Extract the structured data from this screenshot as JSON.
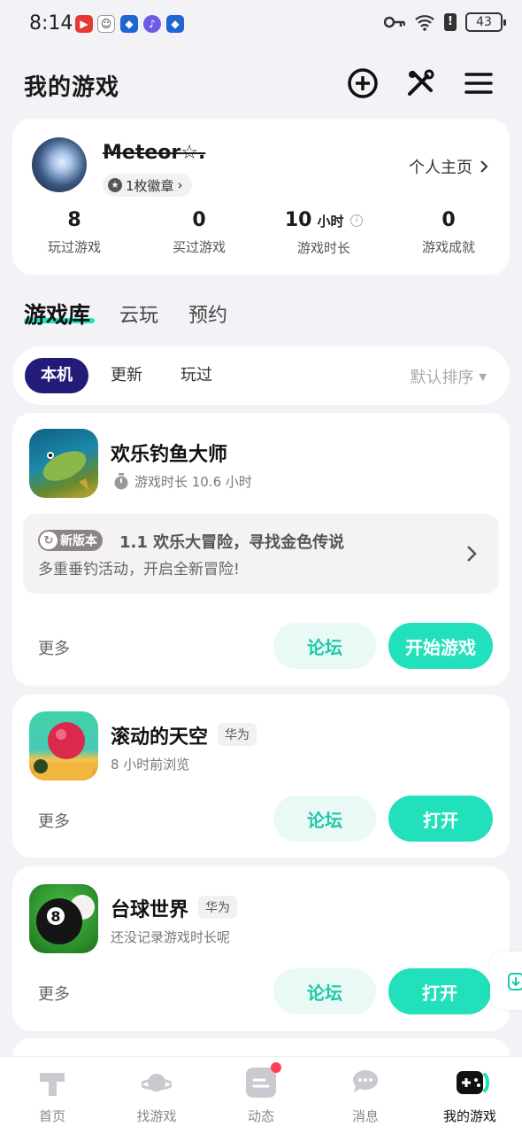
{
  "status_bar": {
    "time": "8:14",
    "battery": "43"
  },
  "header": {
    "title": "我的游戏"
  },
  "profile": {
    "username": "Meteor☆.",
    "badge": "1枚徽章",
    "homepage_link": "个人主页",
    "stats": [
      {
        "value": "8",
        "unit": "",
        "label": "玩过游戏"
      },
      {
        "value": "0",
        "unit": "",
        "label": "买过游戏"
      },
      {
        "value": "10",
        "unit": "小时",
        "label": "游戏时长"
      },
      {
        "value": "0",
        "unit": "",
        "label": "游戏成就"
      }
    ]
  },
  "library_tabs": [
    "游戏库",
    "云玩",
    "预约"
  ],
  "filters": {
    "chips": [
      "本机",
      "更新",
      "玩过"
    ],
    "sort": "默认排序"
  },
  "games": [
    {
      "name": "欢乐钓鱼大师",
      "subtitle": "游戏时长 10.6 小时",
      "news_tag": "新版本",
      "news_title": "1.1 欢乐大冒险，寻找金色传说",
      "news_subtitle": "多重垂钓活动，开启全新冒险!",
      "more": "更多",
      "forum": "论坛",
      "action": "开始游戏"
    },
    {
      "name": "滚动的天空",
      "tag": "华为",
      "subtitle": "8 小时前浏览",
      "more": "更多",
      "forum": "论坛",
      "action": "打开"
    },
    {
      "name": "台球世界",
      "tag": "华为",
      "subtitle": "还没记录游戏时长呢",
      "more": "更多",
      "forum": "论坛",
      "action": "打开"
    }
  ],
  "bottom_nav": [
    "首页",
    "找游戏",
    "动态",
    "消息",
    "我的游戏"
  ],
  "colors": {
    "accent": "#23e0bd",
    "chip_active": "#241a78",
    "notification": "#ff4052"
  }
}
